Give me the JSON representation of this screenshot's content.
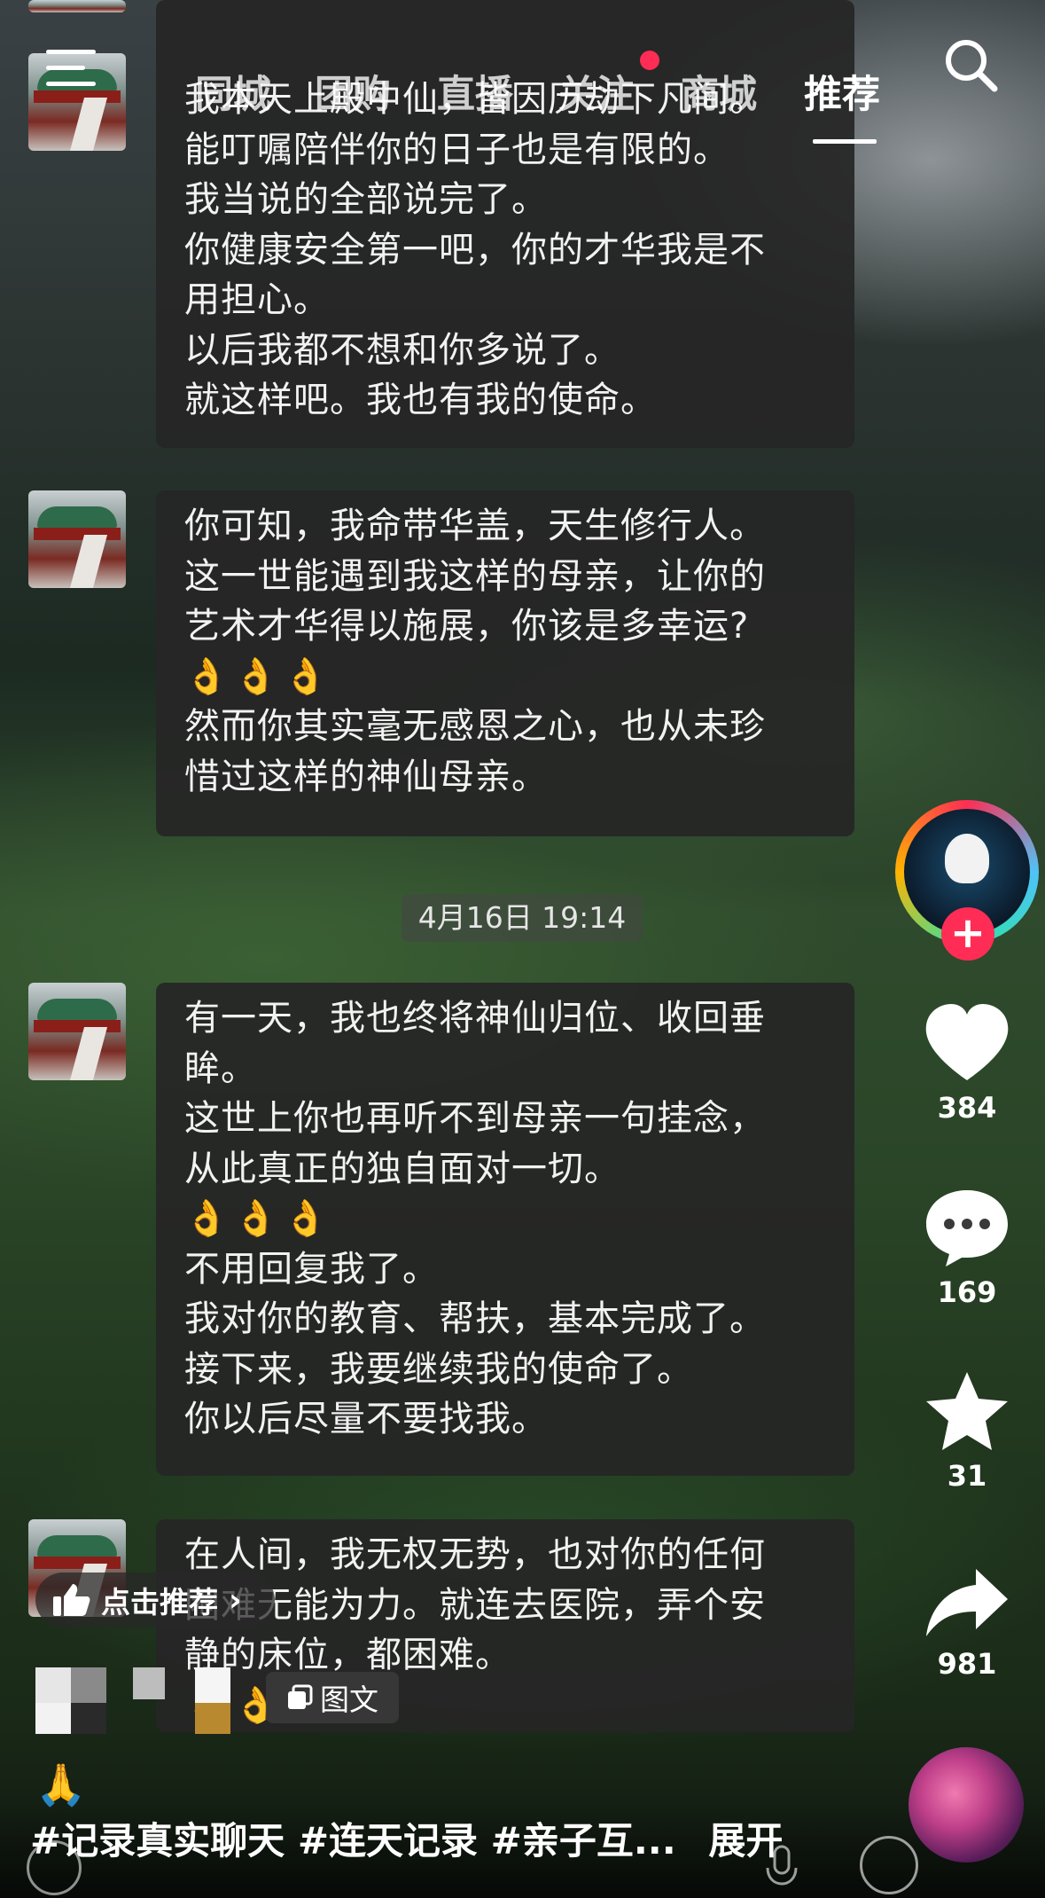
{
  "nav": {
    "tabs": [
      {
        "label": "同城",
        "active": false
      },
      {
        "label": "团购",
        "active": false
      },
      {
        "label": "直播",
        "active": false
      },
      {
        "label": "关注",
        "active": false,
        "dot": true
      },
      {
        "label": "商城",
        "active": false
      },
      {
        "label": "推荐",
        "active": true
      }
    ],
    "menu_icon": "hamburger-menu-icon",
    "search_icon": "search-icon"
  },
  "chat": {
    "bubble1": [
      "我本天上殿中仙，皆因历劫下凡间。",
      "能叮嘱陪伴你的日子也是有限的。",
      "我当说的全部说完了。",
      "你健康安全第一吧，你的才华我是不",
      "用担心。",
      "以后我都不想和你多说了。",
      "就这样吧。我也有我的使命。"
    ],
    "bubble2": [
      "你可知，我命带华盖，天生修行人。",
      "这一世能遇到我这样的母亲，让你的",
      "艺术才华得以施展，你该是多幸运?",
      "👌👌👌",
      "然而你其实毫无感恩之心，也从未珍",
      "惜过这样的神仙母亲。"
    ],
    "timestamp": "4月16日 19:14",
    "bubble3": [
      "有一天，我也终将神仙归位、收回垂",
      "眸。",
      "这世上你也再听不到母亲一句挂念，",
      "从此真正的独自面对一切。",
      "👌👌👌",
      "不用回复我了。",
      "我对你的教育、帮扶，基本完成了。",
      "接下来，我要继续我的使命了。",
      "你以后尽量不要找我。"
    ],
    "bubble4": [
      "在人间，我无权无势，也对你的任何",
      "困难无能为力。就连去医院，弄个安",
      "静的床位，都困难。",
      "👌👌"
    ]
  },
  "sidebar": {
    "likes": "384",
    "comments": "169",
    "favorites": "31",
    "shares": "981"
  },
  "overlay": {
    "recommend_pill": "点击推荐",
    "image_text_tag": "图文",
    "caption": "#记录真实聊天 #连天记录 #亲子互...",
    "expand": "展开",
    "pray_emoji": "🙏"
  },
  "colors": {
    "accent": "#ff2d55",
    "bubble": "#262626",
    "text": "#f2f2f2"
  }
}
